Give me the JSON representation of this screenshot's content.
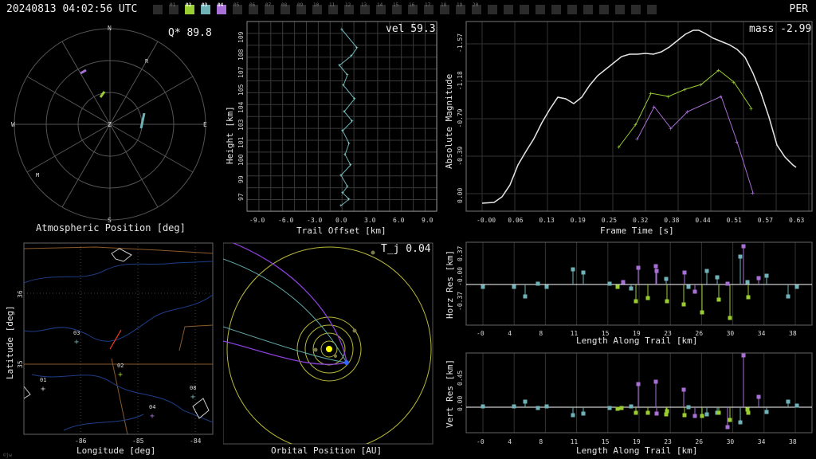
{
  "header": {
    "timestamp": "20240813 04:02:56 UTC",
    "shower": "PER",
    "stations": [
      {
        "label": "",
        "active": false,
        "color": "#2b2b2b"
      },
      {
        "label": "01",
        "active": false,
        "color": "#2b2b2b"
      },
      {
        "label": "02",
        "active": true,
        "color": "#9acd32"
      },
      {
        "label": "03",
        "active": true,
        "color": "#6fb3b8"
      },
      {
        "label": "04",
        "active": true,
        "color": "#a86fd6"
      },
      {
        "label": "05",
        "active": false,
        "color": "#2b2b2b"
      },
      {
        "label": "06",
        "active": false,
        "color": "#2b2b2b"
      },
      {
        "label": "07",
        "active": false,
        "color": "#2b2b2b"
      },
      {
        "label": "08",
        "active": false,
        "color": "#2b2b2b"
      },
      {
        "label": "09",
        "active": false,
        "color": "#2b2b2b"
      },
      {
        "label": "10",
        "active": false,
        "color": "#2b2b2b"
      },
      {
        "label": "11",
        "active": false,
        "color": "#2b2b2b"
      },
      {
        "label": "12",
        "active": false,
        "color": "#2b2b2b"
      },
      {
        "label": "13",
        "active": false,
        "color": "#2b2b2b"
      },
      {
        "label": "14",
        "active": false,
        "color": "#2b2b2b"
      },
      {
        "label": "15",
        "active": false,
        "color": "#2b2b2b"
      },
      {
        "label": "16",
        "active": false,
        "color": "#2b2b2b"
      },
      {
        "label": "17",
        "active": false,
        "color": "#2b2b2b"
      },
      {
        "label": "18",
        "active": false,
        "color": "#2b2b2b"
      },
      {
        "label": "19",
        "active": false,
        "color": "#2b2b2b"
      },
      {
        "label": "20",
        "active": false,
        "color": "#2b2b2b"
      },
      {
        "label": "",
        "active": false,
        "color": "#2b2b2b"
      },
      {
        "label": "",
        "active": false,
        "color": "#2b2b2b"
      },
      {
        "label": "",
        "active": false,
        "color": "#2b2b2b"
      },
      {
        "label": "",
        "active": false,
        "color": "#2b2b2b"
      },
      {
        "label": "",
        "active": false,
        "color": "#2b2b2b"
      },
      {
        "label": "",
        "active": false,
        "color": "#2b2b2b"
      },
      {
        "label": "",
        "active": false,
        "color": "#2b2b2b"
      },
      {
        "label": "",
        "active": false,
        "color": "#2b2b2b"
      },
      {
        "label": "",
        "active": false,
        "color": "#2b2b2b"
      },
      {
        "label": "",
        "active": false,
        "color": "#2b2b2b"
      },
      {
        "label": "",
        "active": false,
        "color": "#2b2b2b"
      }
    ]
  },
  "colors": {
    "station02": "#9acd32",
    "station03": "#6fb3b8",
    "station04": "#a86fd6",
    "fit": "#e6e6e6",
    "sun": "#ffff00",
    "earth": "#3366ff",
    "orbit": "#b8b83a"
  },
  "polar": {
    "title": "Atmospheric Position [deg]",
    "readout": "Q* 89.8",
    "directions": {
      "n": "N",
      "s": "S",
      "e": "E",
      "w": "W",
      "zenith": "Z"
    },
    "markers": {
      "r": "R",
      "m": "M"
    }
  },
  "height_panel": {
    "readout": "vel 59.3",
    "xlabel": "Trail Offset [km]",
    "ylabel": "Height [km]",
    "xticks": [
      "-9.0",
      "-6.0",
      "-3.0",
      "0.0",
      "3.0",
      "6.0",
      "9.0"
    ],
    "yticks": [
      "97",
      "99",
      "100",
      "101",
      "103",
      "104",
      "105",
      "107",
      "108",
      "109"
    ]
  },
  "magnitude_panel": {
    "readout": "mass -2.99",
    "xlabel": "Frame Time [s]",
    "ylabel": "Absolute Magnitude",
    "xticks": [
      "-0.00",
      "0.06",
      "0.13",
      "0.19",
      "0.25",
      "0.32",
      "0.38",
      "0.44",
      "0.51",
      "0.57",
      "0.63"
    ],
    "yticks": [
      "-1.57",
      "-1.18",
      "-0.79",
      "-0.39",
      "0.00"
    ]
  },
  "map_panel": {
    "xlabel": "Longitude [deg]",
    "ylabel": "Latitude [deg]",
    "xticks": [
      "-86",
      "-85",
      "-84"
    ],
    "yticks": [
      "36",
      "35"
    ],
    "stations": [
      "01",
      "02",
      "03",
      "04",
      "08"
    ],
    "corner_text": "©jw"
  },
  "orbit_panel": {
    "readout": "T_j 0.04",
    "xlabel": "Orbital Position [AU]"
  },
  "horz_res": {
    "ylabel": "Horz Res [km]",
    "xlabel": "Length Along Trail [km]",
    "xticks": [
      "-0",
      "4",
      "8",
      "11",
      "15",
      "19",
      "23",
      "26",
      "30",
      "34",
      "38"
    ],
    "yticks": [
      "0.37",
      "-0.00",
      "-0.37"
    ]
  },
  "vert_res": {
    "ylabel": "Vert Res [km]",
    "xlabel": "Length Along Trail [km]",
    "xticks": [
      "-0",
      "4",
      "8",
      "11",
      "15",
      "19",
      "23",
      "26",
      "30",
      "34",
      "38"
    ],
    "yticks": [
      "0.45",
      "0.00"
    ]
  }
}
